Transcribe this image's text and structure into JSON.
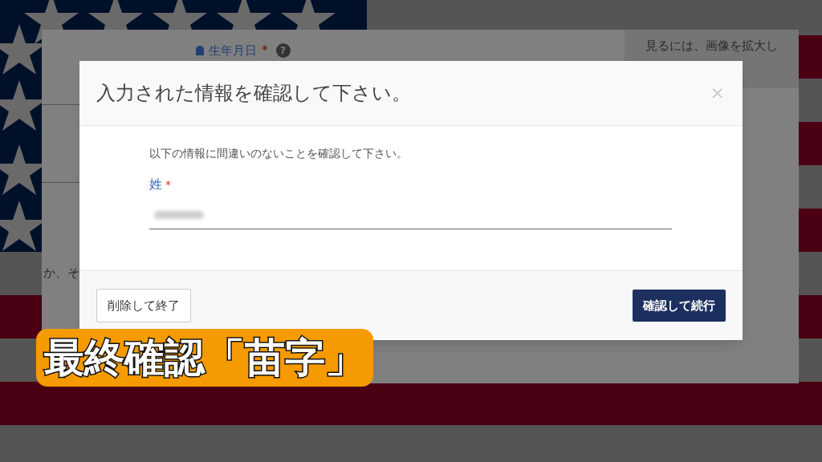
{
  "background_page": {
    "birthdate_label": "生年月日",
    "required_mark": "*",
    "help_icon": "?",
    "side_note": "見るには、画像を拡大し",
    "fragment": "か、そ"
  },
  "modal": {
    "title": "入力された情報を確認して下さい。",
    "close": "×",
    "message": "以下の情報に間違いのないことを確認して下さい。",
    "field": {
      "label": "姓",
      "required": true
    },
    "buttons": [
      {
        "label": "削除して終了",
        "kind": "secondary"
      },
      {
        "label": "確認して続行",
        "kind": "primary"
      }
    ]
  },
  "caption": "最終確認「苗字」"
}
